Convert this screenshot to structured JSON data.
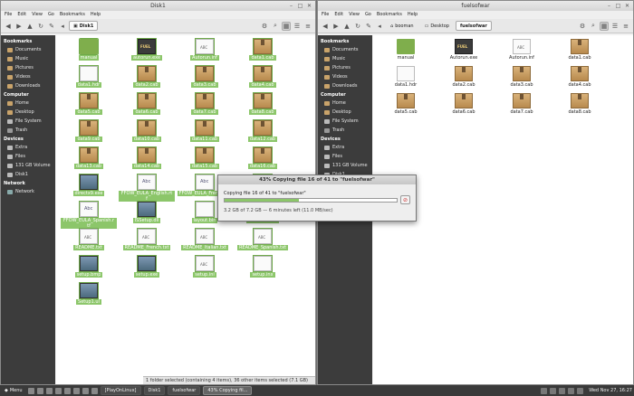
{
  "left_window": {
    "title": "Disk1",
    "menu": [
      "File",
      "Edit",
      "View",
      "Go",
      "Bookmarks",
      "Help"
    ],
    "breadcrumbs": [
      "Disk1"
    ],
    "sidebar": {
      "bookmarks_header": "Bookmarks",
      "bookmarks": [
        "Documents",
        "Music",
        "Pictures",
        "Videos",
        "Downloads"
      ],
      "computer_header": "Computer",
      "computer": [
        "Home",
        "Desktop",
        "File System",
        "Trash"
      ],
      "devices_header": "Devices",
      "devices": [
        "Extra",
        "Files",
        "131 GB Volume",
        "Disk1"
      ],
      "network_header": "Network",
      "network": [
        "Network"
      ]
    },
    "files": [
      {
        "name": "manual",
        "type": "folder",
        "selected": true
      },
      {
        "name": "autorun.exe",
        "type": "exe",
        "selected": true
      },
      {
        "name": "Autorun.inf",
        "type": "txt",
        "selected": true
      },
      {
        "name": "data1.cab",
        "type": "cab",
        "selected": true
      },
      {
        "name": "data1.hdr",
        "type": "hdr",
        "selected": true
      },
      {
        "name": "data2.cab",
        "type": "cab",
        "selected": true
      },
      {
        "name": "data3.cab",
        "type": "cab",
        "selected": true
      },
      {
        "name": "data4.cab",
        "type": "cab",
        "selected": true
      },
      {
        "name": "data5.cab",
        "type": "cab",
        "selected": true
      },
      {
        "name": "data6.cab",
        "type": "cab",
        "selected": true
      },
      {
        "name": "data7.cab",
        "type": "cab",
        "selected": true
      },
      {
        "name": "data8.cab",
        "type": "cab",
        "selected": true
      },
      {
        "name": "data9.cab",
        "type": "cab",
        "selected": true
      },
      {
        "name": "data10.cab",
        "type": "cab",
        "selected": true
      },
      {
        "name": "data11.cab",
        "type": "cab",
        "selected": true
      },
      {
        "name": "data12.cab",
        "type": "cab",
        "selected": true
      },
      {
        "name": "data13.cab",
        "type": "cab",
        "selected": true
      },
      {
        "name": "data14.cab",
        "type": "cab",
        "selected": true
      },
      {
        "name": "data15.cab",
        "type": "cab",
        "selected": true
      },
      {
        "name": "data16.cab",
        "type": "cab",
        "selected": true
      },
      {
        "name": "directx9.exe",
        "type": "img",
        "selected": true
      },
      {
        "name": "FFOW_EULA_English.rtf",
        "type": "doc",
        "selected": true
      },
      {
        "name": "FFOW_EULA_French.rtf",
        "type": "doc",
        "selected": true
      },
      {
        "name": "FFOW_EULA_Italian.rtf",
        "type": "doc",
        "selected": true
      },
      {
        "name": "FFOW_EULA_Spanish.rtf",
        "type": "doc",
        "selected": true
      },
      {
        "name": "ISSetup.dll",
        "type": "img",
        "selected": true
      },
      {
        "name": "layout.bin",
        "type": "hdr",
        "selected": true
      },
      {
        "name": "NetFx64.exe",
        "type": "img",
        "selected": true
      },
      {
        "name": "README.txt",
        "type": "txt",
        "selected": true
      },
      {
        "name": "README_French.txt",
        "type": "txt",
        "selected": true
      },
      {
        "name": "README_Italian.txt",
        "type": "txt",
        "selected": true
      },
      {
        "name": "README_Spanish.txt",
        "type": "txt",
        "selected": true
      },
      {
        "name": "setup.bmp",
        "type": "img",
        "selected": true
      },
      {
        "name": "setup.exe",
        "type": "img",
        "selected": true
      },
      {
        "name": "setup.ini",
        "type": "txt",
        "selected": true
      },
      {
        "name": "setup.inx",
        "type": "hdr",
        "selected": true
      },
      {
        "name": "Setup1.ul",
        "type": "img",
        "selected": true
      }
    ],
    "status": "1 folder selected (containing 4 items), 36 other items selected (7.1 GB)"
  },
  "right_window": {
    "title": "fuelsofwar",
    "menu": [
      "File",
      "Edit",
      "View",
      "Go",
      "Bookmarks",
      "Help"
    ],
    "breadcrumbs": [
      "booman",
      "Desktop",
      "fuelsofwar"
    ],
    "sidebar": {
      "bookmarks_header": "Bookmarks",
      "bookmarks": [
        "Documents",
        "Music",
        "Pictures",
        "Videos",
        "Downloads"
      ],
      "computer_header": "Computer",
      "computer": [
        "Home",
        "Desktop",
        "File System",
        "Trash"
      ],
      "devices_header": "Devices",
      "devices": [
        "Extra",
        "Files",
        "131 GB Volume",
        "Disk1"
      ]
    },
    "files": [
      {
        "name": "manual",
        "type": "folder"
      },
      {
        "name": "Autorun.exe",
        "type": "exe"
      },
      {
        "name": "Autorun.inf",
        "type": "txt"
      },
      {
        "name": "data1.cab",
        "type": "cab"
      },
      {
        "name": "data1.hdr",
        "type": "hdr"
      },
      {
        "name": "data2.cab",
        "type": "cab"
      },
      {
        "name": "data3.cab",
        "type": "cab"
      },
      {
        "name": "data4.cab",
        "type": "cab"
      },
      {
        "name": "data5.cab",
        "type": "cab"
      },
      {
        "name": "data6.cab",
        "type": "cab"
      },
      {
        "name": "data7.cab",
        "type": "cab"
      },
      {
        "name": "data8.cab",
        "type": "cab"
      }
    ]
  },
  "copy_dialog": {
    "title": "43% Copying file 16 of 41 to \"fuelsofwar\"",
    "message": "Copying file 16 of 41 to \"fuelsofwar\"",
    "progress": 0.43,
    "details": "3.2 GB of 7.2 GB — 6 minutes left (11.0 MB/sec)"
  },
  "panel": {
    "menu_label": "Menu",
    "tasks": [
      "[PlayOnLinux]",
      "Disk1",
      "fuelsofwar",
      "43% Copying fil..."
    ],
    "clock": "Wed Nov 27, 16:27"
  }
}
